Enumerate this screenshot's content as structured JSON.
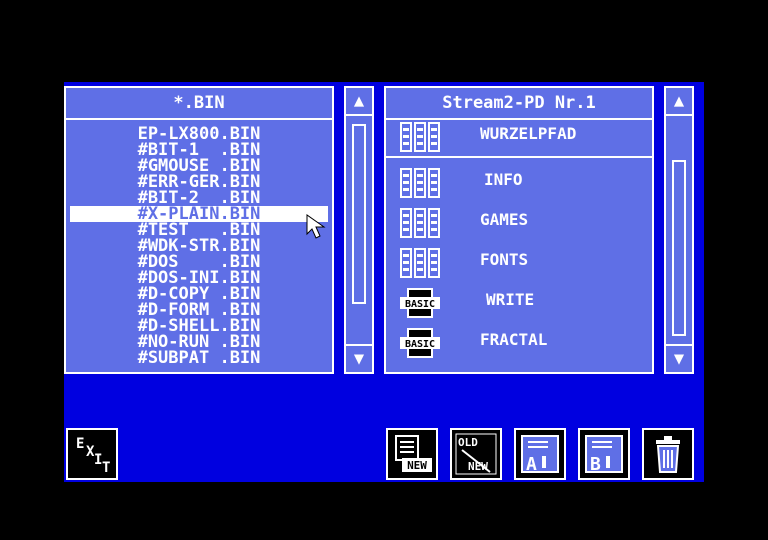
{
  "left_panel": {
    "title": "*.BIN",
    "files": [
      "EP-LX800.BIN",
      "#BIT-1  .BIN",
      "#GMOUSE .BIN",
      "#ERR-GER.BIN",
      "#BIT-2  .BIN",
      "#X-PLAIN.BIN",
      "#TEST   .BIN",
      "#WDK-STR.BIN",
      "#DOS    .BIN",
      "#DOS-INI.BIN",
      "#D-COPY .BIN",
      "#D-FORM .BIN",
      "#D-SHELL.BIN",
      "#NO-RUN .BIN",
      "#SUBPAT .BIN"
    ],
    "selected_index": 5
  },
  "right_panel": {
    "title": "Stream2-PD  Nr.1",
    "root_label": "WURZELPFAD",
    "entries": [
      {
        "label": "INFO",
        "icon": "folder-icon"
      },
      {
        "label": "GAMES",
        "icon": "folder-icon"
      },
      {
        "label": "FONTS",
        "icon": "folder-icon"
      },
      {
        "label": "WRITE",
        "icon": "basic-icon"
      },
      {
        "label": "FRACTAL",
        "icon": "basic-icon"
      }
    ]
  },
  "scroll": {
    "up": "▲",
    "down": "▼"
  },
  "icons": {
    "basic_text": "BASIC",
    "new_text": "NEW",
    "old_text": "OLD",
    "a_text": "A",
    "b_text": "B",
    "exit_letters": [
      "E",
      "X",
      "I",
      "T"
    ]
  },
  "colors": {
    "background": "#0000e0",
    "panel": "#5f6fe6",
    "foreground": "#ffffff"
  }
}
